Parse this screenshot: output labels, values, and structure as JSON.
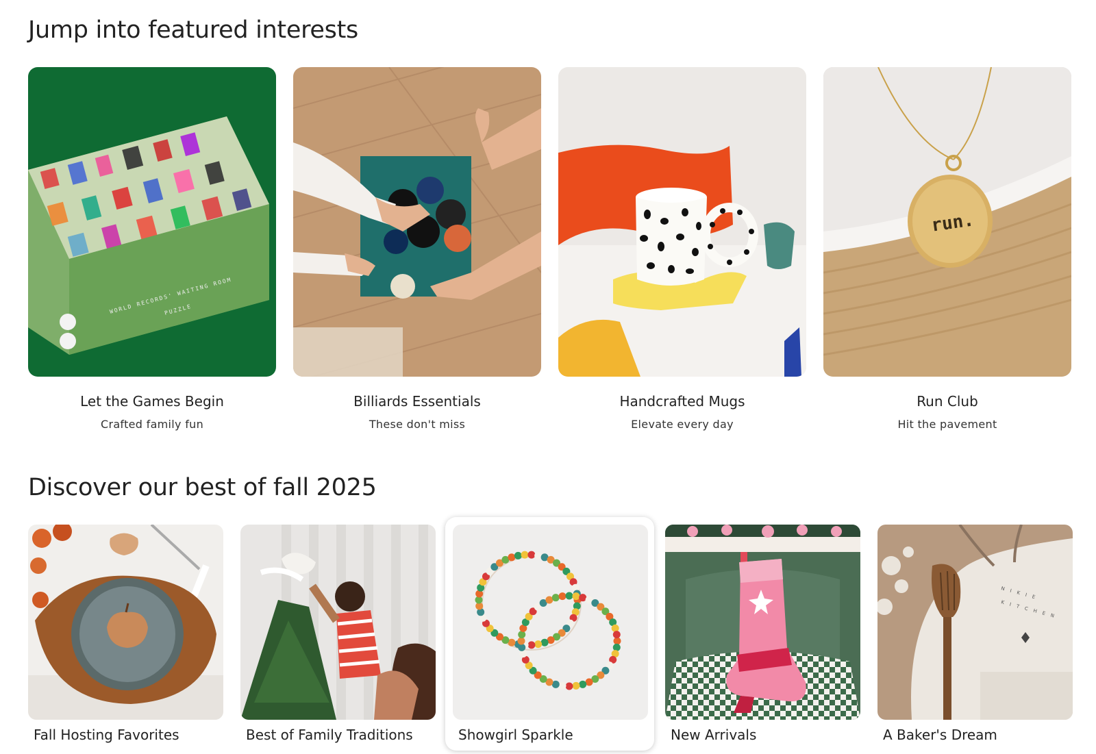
{
  "featured": {
    "title": "Jump into featured interests",
    "cards": [
      {
        "title": "Let the Games Begin",
        "subtitle": "Crafted family fun",
        "image_icon": "puzzle-box",
        "box_text": "WORLD RECORDS' WAITING ROOM",
        "box_sub": "PUZZLE"
      },
      {
        "title": "Billiards Essentials",
        "subtitle": "These don't miss",
        "image_icon": "billiards-puzzle"
      },
      {
        "title": "Handcrafted Mugs",
        "subtitle": "Elevate every day",
        "image_icon": "dotted-mug"
      },
      {
        "title": "Run Club",
        "subtitle": "Hit the pavement",
        "image_icon": "run-necklace",
        "pendant_text": "run."
      }
    ]
  },
  "discover": {
    "title": "Discover our best of fall 2025",
    "cards": [
      {
        "label": "Fall Hosting Favorites",
        "image_icon": "pumpkin-plate"
      },
      {
        "label": "Best of Family Traditions",
        "image_icon": "tree-ornament"
      },
      {
        "label": "Showgirl Sparkle",
        "image_icon": "bead-bracelets",
        "selected": true
      },
      {
        "label": "New Arrivals",
        "image_icon": "cowboy-stocking"
      },
      {
        "label": "A Baker's Dream",
        "image_icon": "apron-spoon"
      }
    ]
  },
  "colors": {
    "text": "#222222",
    "background": "#ffffff"
  }
}
